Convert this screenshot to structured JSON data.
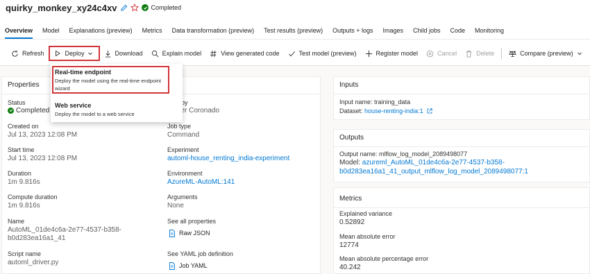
{
  "header": {
    "job_name": "quirky_monkey_xy24c4xv",
    "status": "Completed",
    "colors": {
      "success": "#107c10",
      "accent": "#0078d4",
      "highlight": "#d13438"
    }
  },
  "tabs": [
    {
      "label": "Overview",
      "active": true
    },
    {
      "label": "Model"
    },
    {
      "label": "Explanations (preview)"
    },
    {
      "label": "Metrics"
    },
    {
      "label": "Data transformation (preview)"
    },
    {
      "label": "Test results (preview)"
    },
    {
      "label": "Outputs + logs"
    },
    {
      "label": "Images"
    },
    {
      "label": "Child jobs"
    },
    {
      "label": "Code"
    },
    {
      "label": "Monitoring"
    }
  ],
  "toolbar": {
    "refresh": "Refresh",
    "deploy": "Deploy",
    "download": "Download",
    "explain": "Explain model",
    "view_code": "View generated code",
    "test_model": "Test model (preview)",
    "register": "Register model",
    "cancel": "Cancel",
    "delete": "Delete",
    "compare": "Compare (preview)"
  },
  "deploy_menu": {
    "realtime_title": "Real-time endpoint",
    "realtime_desc": "Deploy the model using the real-time endpoint wizard",
    "web_title": "Web service",
    "web_desc": "Deploy the model to a web service"
  },
  "properties": {
    "title": "Properties",
    "status_label": "Status",
    "status_value": "Completed",
    "created_on_label": "Created on",
    "created_on_value": "Jul 13, 2023 12:08 PM",
    "start_time_label": "Start time",
    "start_time_value": "Jul 13, 2023 12:08 PM",
    "duration_label": "Duration",
    "duration_value": "1m 9.816s",
    "compute_duration_label": "Compute duration",
    "compute_duration_value": "1m 9.816s",
    "name_label": "Name",
    "name_value_line1": "AutoML_01de4c6a-2e77-4537-b358-",
    "name_value_line2": "b0d283ea16a1_41",
    "script_label": "Script name",
    "script_value": "automl_driver.py",
    "created_by_label": "ated by",
    "created_by_value": "topher Coronado",
    "job_type_label": "Job type",
    "job_type_value": "Command",
    "experiment_label": "Experiment",
    "experiment_value": "automl-house_renting_india-experiment",
    "environment_label": "Environment",
    "environment_value": "AzureML-AutoML:141",
    "arguments_label": "Arguments",
    "arguments_value": "None",
    "see_all_label": "See all properties",
    "raw_json": "Raw JSON",
    "yaml_label": "See YAML job definition",
    "job_yaml": "Job YAML"
  },
  "inputs": {
    "title": "Inputs",
    "input_name": "Input name: training_data",
    "dataset_prefix": "Dataset: ",
    "dataset_value": "house-renting-india:1"
  },
  "outputs": {
    "title": "Outputs",
    "output_name": "Output name: mlflow_log_model_2089498077",
    "model_prefix": "Model: ",
    "model_value_line1": "azureml_AutoML_01de4c6a-2e77-4537-b358-",
    "model_value_line2": "b0d283ea16a1_41_output_mlflow_log_model_2089498077:1"
  },
  "metrics": {
    "title": "Metrics",
    "items": [
      {
        "label": "Explained variance",
        "value": "0.52892"
      },
      {
        "label": "Mean absolute error",
        "value": "12774"
      },
      {
        "label": "Mean absolute percentage error",
        "value": "40.242"
      }
    ]
  }
}
